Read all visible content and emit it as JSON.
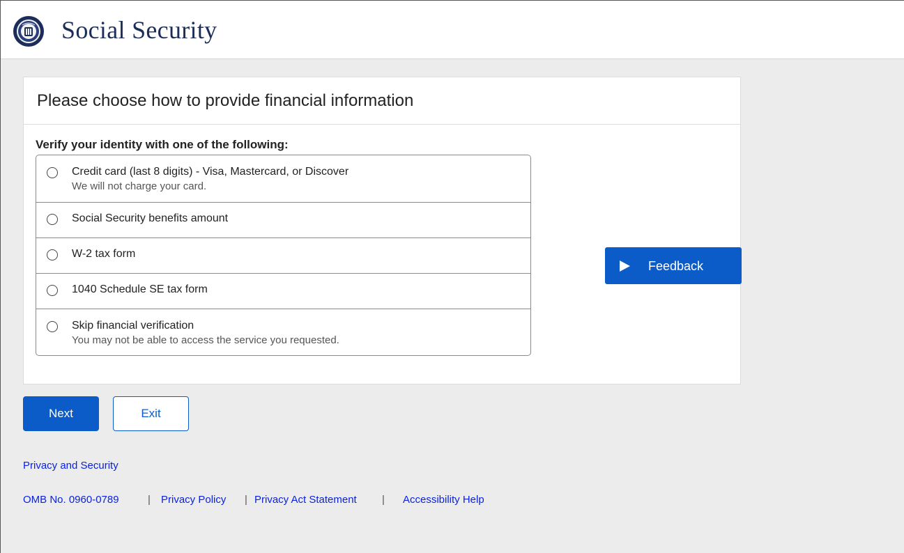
{
  "header": {
    "brand": "Social Security",
    "seal_icon": "ssa-seal-icon"
  },
  "card": {
    "title": "Please choose how to provide financial information",
    "prompt": "Verify your identity with one of the following:",
    "options": [
      {
        "label": "Credit card (last 8 digits) - Visa, Mastercard, or Discover",
        "sub": "We will not charge your card.",
        "selected": false
      },
      {
        "label": "Social Security benefits amount",
        "sub": "",
        "selected": false
      },
      {
        "label": "W-2 tax form",
        "sub": "",
        "selected": false
      },
      {
        "label": "1040 Schedule SE tax form",
        "sub": "",
        "selected": false
      },
      {
        "label": "Skip financial verification",
        "sub": "You may not be able to access the service you requested.",
        "selected": false
      }
    ]
  },
  "feedback": {
    "label": "Feedback",
    "icon": "play-triangle-icon"
  },
  "actions": {
    "next_label": "Next",
    "exit_label": "Exit"
  },
  "footer": {
    "privacy_security": "Privacy and Security",
    "omb": "OMB No. 0960-0789",
    "privacy_policy": "Privacy Policy",
    "privacy_act": "Privacy Act Statement",
    "accessibility": "Accessibility Help",
    "separator": "|"
  },
  "colors": {
    "primary": "#0b5cc9",
    "link": "#0a22e0",
    "brand_text": "#1c2d5a",
    "background": "#ececec"
  }
}
